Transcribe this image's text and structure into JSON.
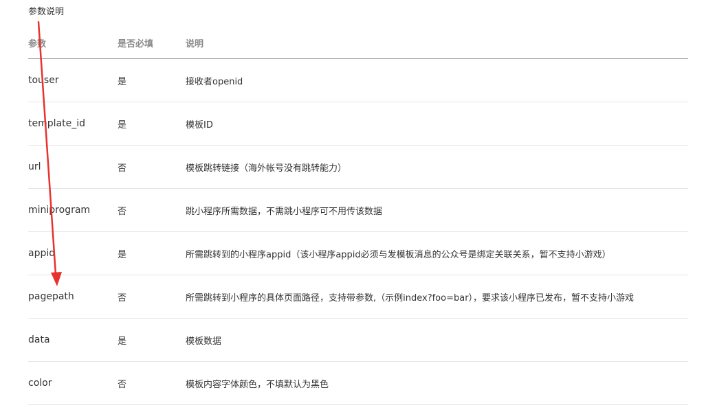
{
  "section_title": "参数说明",
  "table": {
    "headers": {
      "param": "参数",
      "required": "是否必填",
      "description": "说明"
    },
    "rows": [
      {
        "param": "touser",
        "required": "是",
        "description": "接收者openid"
      },
      {
        "param": "template_id",
        "required": "是",
        "description": "模板ID"
      },
      {
        "param": "url",
        "required": "否",
        "description": "模板跳转链接（海外帐号没有跳转能力）"
      },
      {
        "param": "miniprogram",
        "required": "否",
        "description": "跳小程序所需数据，不需跳小程序可不用传该数据"
      },
      {
        "param": "appid",
        "required": "是",
        "description": "所需跳转到的小程序appid（该小程序appid必须与发模板消息的公众号是绑定关联关系，暂不支持小游戏）"
      },
      {
        "param": "pagepath",
        "required": "否",
        "description": "所需跳转到小程序的具体页面路径，支持带参数,（示例index?foo=bar），要求该小程序已发布，暂不支持小游戏"
      },
      {
        "param": "data",
        "required": "是",
        "description": "模板数据"
      },
      {
        "param": "color",
        "required": "否",
        "description": "模板内容字体颜色，不填默认为黑色"
      }
    ]
  },
  "annotation": {
    "arrow_color": "#e8322d"
  }
}
